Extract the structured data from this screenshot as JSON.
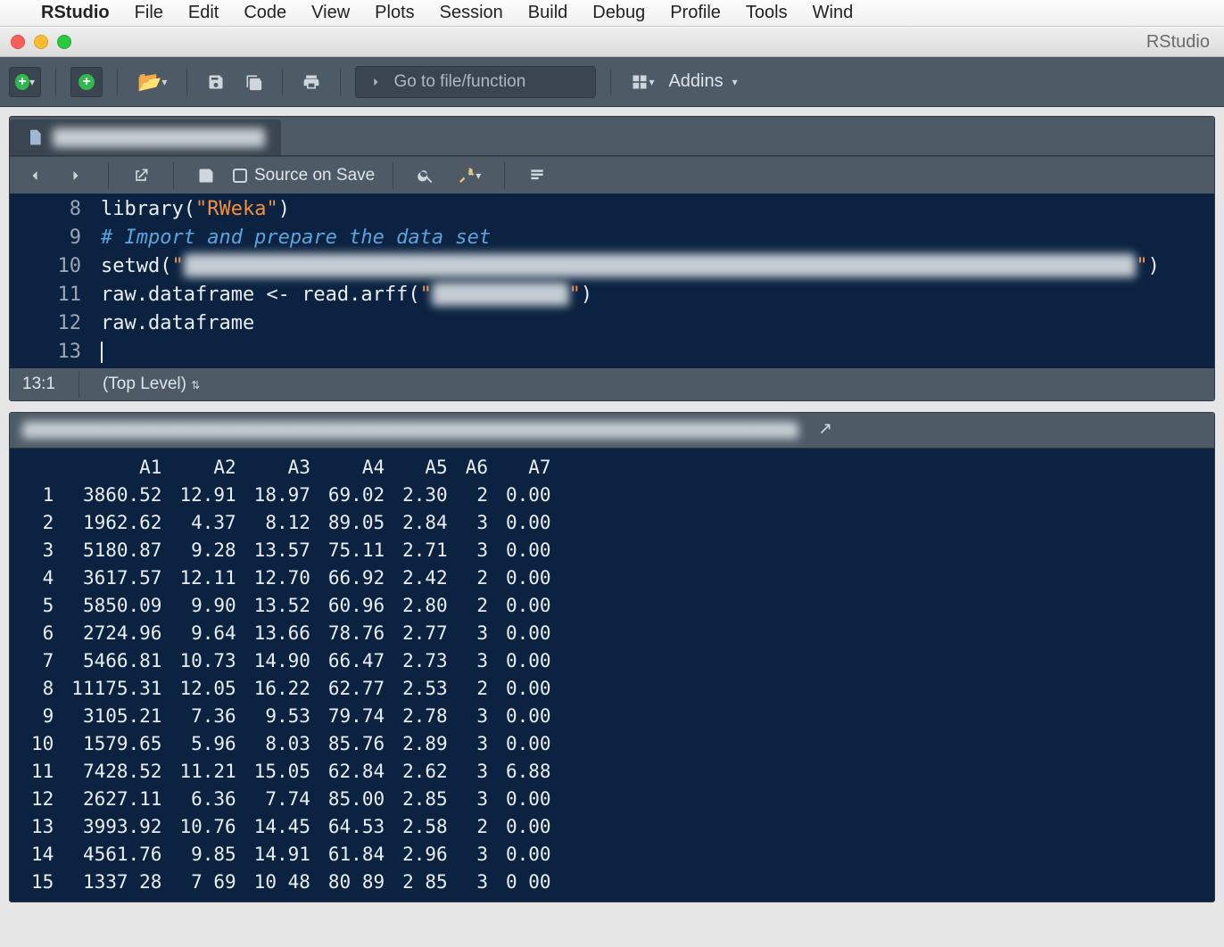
{
  "mac_menu": {
    "apple": "",
    "appname": "RStudio",
    "items": [
      "File",
      "Edit",
      "Code",
      "View",
      "Plots",
      "Session",
      "Build",
      "Debug",
      "Profile",
      "Tools",
      "Wind"
    ]
  },
  "window": {
    "title": "RStudio"
  },
  "toolbar": {
    "goto_placeholder": "Go to file/function",
    "addins_label": "Addins"
  },
  "editor": {
    "tab_label": "██████████████████",
    "source_on_save": "Source on Save",
    "lines": [
      {
        "n": "8",
        "html": "<span class='tok-fn'>library</span>(<span class='tok-str'>\"RWeka\"</span>)"
      },
      {
        "n": "9",
        "html": "<span class='tok-cmt'># Import and prepare the data set</span>"
      },
      {
        "n": "10",
        "html": "<span class='tok-fn'>setwd</span>(<span class='tok-str'>\"</span><span class='blurred'>████████████████████████████████████████████████████████████████████████████████</span><span class='tok-str'>\"</span>)"
      },
      {
        "n": "11",
        "html": "raw.dataframe <span class='tok-op'>&lt;-</span> <span class='tok-fn'>read.arff</span>(<span class='tok-str'>\"</span><span class='blurred'>███████████</span><span class='tok-str'>\"</span>)"
      },
      {
        "n": "12",
        "html": "raw.dataframe"
      },
      {
        "n": "13",
        "html": "<span class='cursor'></span>"
      }
    ],
    "status_pos": "13:1",
    "status_scope": "(Top Level)"
  },
  "console": {
    "path_label": "████████████████████████████████████████████████████████████████████████████",
    "headers": [
      "",
      "A1",
      "A2",
      "A3",
      "A4",
      "A5",
      "A6",
      "A7"
    ],
    "rows": [
      [
        "1",
        "3860.52",
        "12.91",
        "18.97",
        "69.02",
        "2.30",
        "2",
        "0.00"
      ],
      [
        "2",
        "1962.62",
        "4.37",
        "8.12",
        "89.05",
        "2.84",
        "3",
        "0.00"
      ],
      [
        "3",
        "5180.87",
        "9.28",
        "13.57",
        "75.11",
        "2.71",
        "3",
        "0.00"
      ],
      [
        "4",
        "3617.57",
        "12.11",
        "12.70",
        "66.92",
        "2.42",
        "2",
        "0.00"
      ],
      [
        "5",
        "5850.09",
        "9.90",
        "13.52",
        "60.96",
        "2.80",
        "2",
        "0.00"
      ],
      [
        "6",
        "2724.96",
        "9.64",
        "13.66",
        "78.76",
        "2.77",
        "3",
        "0.00"
      ],
      [
        "7",
        "5466.81",
        "10.73",
        "14.90",
        "66.47",
        "2.73",
        "3",
        "0.00"
      ],
      [
        "8",
        "11175.31",
        "12.05",
        "16.22",
        "62.77",
        "2.53",
        "2",
        "0.00"
      ],
      [
        "9",
        "3105.21",
        "7.36",
        "9.53",
        "79.74",
        "2.78",
        "3",
        "0.00"
      ],
      [
        "10",
        "1579.65",
        "5.96",
        "8.03",
        "85.76",
        "2.89",
        "3",
        "0.00"
      ],
      [
        "11",
        "7428.52",
        "11.21",
        "15.05",
        "62.84",
        "2.62",
        "3",
        "6.88"
      ],
      [
        "12",
        "2627.11",
        "6.36",
        "7.74",
        "85.00",
        "2.85",
        "3",
        "0.00"
      ],
      [
        "13",
        "3993.92",
        "10.76",
        "14.45",
        "64.53",
        "2.58",
        "2",
        "0.00"
      ],
      [
        "14",
        "4561.76",
        "9.85",
        "14.91",
        "61.84",
        "2.96",
        "3",
        "0.00"
      ],
      [
        "15",
        "1337 28",
        "7 69",
        "10 48",
        "80 89",
        "2 85",
        "3",
        "0 00"
      ]
    ]
  }
}
